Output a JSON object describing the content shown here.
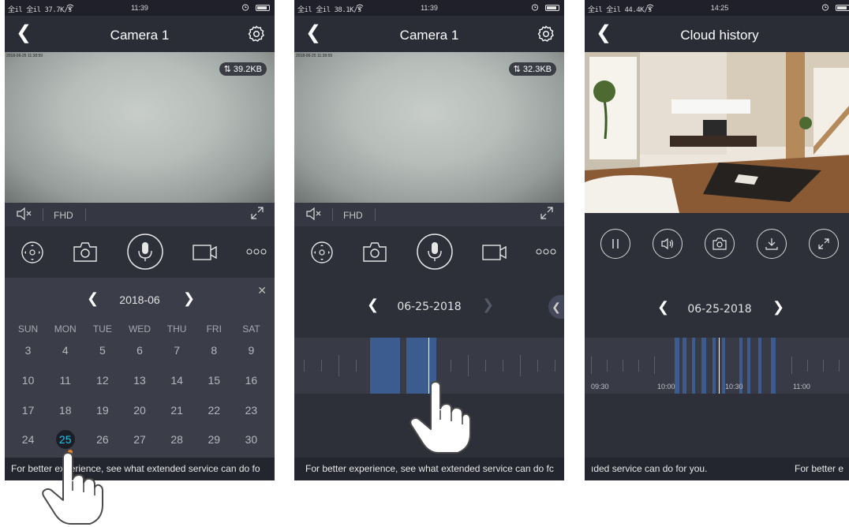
{
  "colors": {
    "accent": "#24c4e8",
    "record_block": "#3c5c90",
    "dot": "#e8842a",
    "bg": "#2d2f39"
  },
  "screen1": {
    "status": {
      "signal": "全il 全il 37.7K/s",
      "time": "11:39"
    },
    "title": "Camera 1",
    "video_timestamp": "2018-06-25 11:38:59",
    "data_rate": "39.2KB",
    "quality": "FHD",
    "icons": [
      "ptz-icon",
      "snapshot-icon",
      "microphone-icon",
      "record-icon",
      "more-icon"
    ],
    "calendar": {
      "month": "2018-06",
      "weekdays": [
        "SUN",
        "MON",
        "TUE",
        "WED",
        "THU",
        "FRI",
        "SAT"
      ],
      "weeks": [
        [
          "3",
          "4",
          "5",
          "6",
          "7",
          "8",
          "9"
        ],
        [
          "10",
          "11",
          "12",
          "13",
          "14",
          "15",
          "16"
        ],
        [
          "17",
          "18",
          "19",
          "20",
          "21",
          "22",
          "23"
        ],
        [
          "24",
          "25",
          "26",
          "27",
          "28",
          "29",
          "30"
        ]
      ],
      "selected": "25"
    },
    "banner": "For better experience, see what extended service can do fo"
  },
  "screen2": {
    "status": {
      "signal": "全il 全il 38.1K/s",
      "time": "11:39"
    },
    "title": "Camera 1",
    "video_timestamp": "2018-06-25 11:38:59",
    "data_rate": "32.3KB",
    "quality": "FHD",
    "date": "06-25-2018",
    "banner": "For better experience, see what extended service can do fc"
  },
  "screen3": {
    "status": {
      "signal": "全il 全il 44.4K/s",
      "time": "14:25"
    },
    "title": "Cloud history",
    "date": "06-25-2018",
    "timeline_labels": [
      "09:30",
      "10:00",
      "10:30",
      "11:00"
    ],
    "banner_a": "ıded service can do for you.",
    "banner_b": "For better e"
  }
}
